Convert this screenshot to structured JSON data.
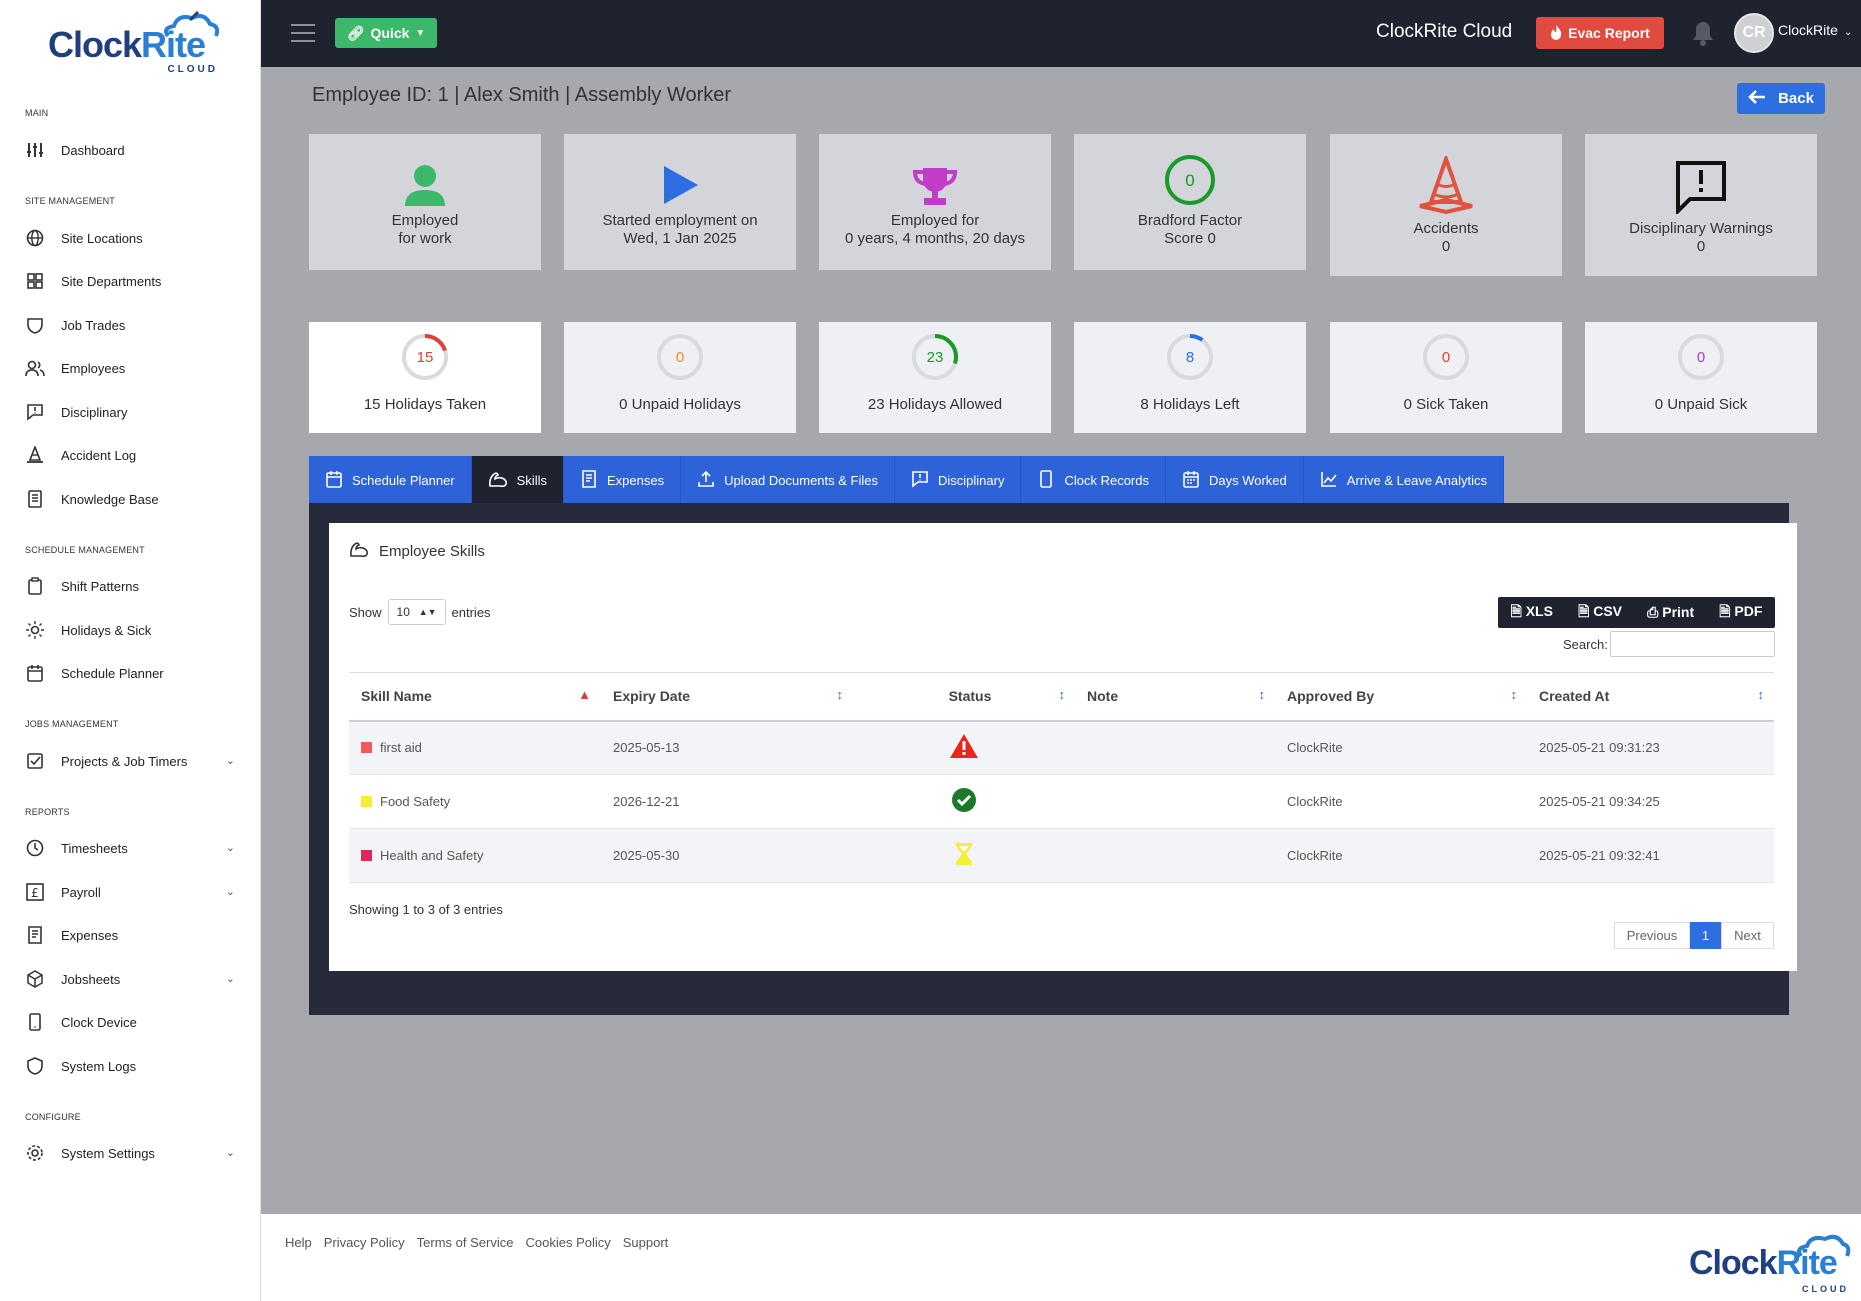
{
  "app": {
    "brand": "ClockRite Cloud",
    "logo_word_1": "Clock",
    "logo_word_2": "Rite",
    "logo_sub": "CLOUD"
  },
  "topbar": {
    "quick_label": "Quick",
    "evac_label": "Evac Report",
    "avatar_initials": "CR",
    "user_name": "ClockRite"
  },
  "sidebar": {
    "sections": [
      "MAIN",
      "SITE MANAGEMENT",
      "SCHEDULE MANAGEMENT",
      "JOBS MANAGEMENT",
      "REPORTS",
      "CONFIGURE"
    ],
    "items": [
      {
        "label": "Dashboard",
        "icon": "sliders-icon"
      },
      {
        "label": "Site Locations",
        "icon": "globe-icon"
      },
      {
        "label": "Site Departments",
        "icon": "grid-icon"
      },
      {
        "label": "Job Trades",
        "icon": "shield-icon"
      },
      {
        "label": "Employees",
        "icon": "users-icon"
      },
      {
        "label": "Disciplinary",
        "icon": "message-alert-icon"
      },
      {
        "label": "Accident Log",
        "icon": "cone-icon"
      },
      {
        "label": "Knowledge Base",
        "icon": "book-icon"
      },
      {
        "label": "Shift Patterns",
        "icon": "clipboard-icon"
      },
      {
        "label": "Holidays & Sick",
        "icon": "sun-icon"
      },
      {
        "label": "Schedule Planner",
        "icon": "calendar-icon"
      },
      {
        "label": "Projects & Job Timers",
        "icon": "checkbox-icon"
      },
      {
        "label": "Timesheets",
        "icon": "clock-icon"
      },
      {
        "label": "Payroll",
        "icon": "pound-icon"
      },
      {
        "label": "Expenses",
        "icon": "receipt-icon"
      },
      {
        "label": "Jobsheets",
        "icon": "box-icon"
      },
      {
        "label": "Clock Device",
        "icon": "tablet-icon"
      },
      {
        "label": "System Logs",
        "icon": "shield-icon"
      },
      {
        "label": "System Settings",
        "icon": "gear-icon"
      }
    ]
  },
  "page": {
    "title": "Employee ID: 1 | Alex Smith | Assembly Worker",
    "back_label": "Back"
  },
  "cards": [
    {
      "line1": "Employed",
      "line2": "for work",
      "icon": "user-icon",
      "color": "#3cb86a"
    },
    {
      "line1": "Started employment on",
      "line2": "Wed, 1 Jan 2025",
      "icon": "play-icon",
      "color": "#2d6fe0"
    },
    {
      "line1": "Employed for",
      "line2": "0 years, 4 months, 20 days",
      "icon": "trophy-icon",
      "color": "#c23dc7"
    },
    {
      "line1": "Bradford Factor",
      "line2": "Score 0",
      "icon": "score-ring",
      "value": "0",
      "color": "#1a9a2a"
    },
    {
      "line1": "Accidents",
      "line2": "0",
      "icon": "cone-icon",
      "color": "#e0533f"
    },
    {
      "line1": "Disciplinary Warnings",
      "line2": "0",
      "icon": "message-alert-icon",
      "color": "#111111"
    }
  ],
  "stats": [
    {
      "value": "15",
      "label": "15 Holidays Taken",
      "fraction": 0.2,
      "color": "#d9433a"
    },
    {
      "value": "0",
      "label": "0 Unpaid Holidays",
      "fraction": 0,
      "color": "#f08c2e"
    },
    {
      "value": "23",
      "label": "23 Holidays Allowed",
      "fraction": 0.3,
      "color": "#1a9a2a"
    },
    {
      "value": "8",
      "label": "8 Holidays Left",
      "fraction": 0.1,
      "color": "#2d6fe0"
    },
    {
      "value": "0",
      "label": "0 Sick Taken",
      "fraction": 0,
      "color": "#d9433a"
    },
    {
      "value": "0",
      "label": "0 Unpaid Sick",
      "fraction": 0,
      "color": "#9b3fd9"
    }
  ],
  "tabs": [
    "Schedule Planner",
    "Skills",
    "Expenses",
    "Upload Documents & Files",
    "Disciplinary",
    "Clock Records",
    "Days Worked",
    "Arrive & Leave Analytics"
  ],
  "skills": {
    "heading": "Employee Skills",
    "show_label": "Show",
    "entries_label": "entries",
    "page_size": "10",
    "exports": [
      "XLS",
      "CSV",
      "Print",
      "PDF"
    ],
    "search_label": "Search:",
    "columns": [
      "Skill Name",
      "Expiry Date",
      "Status",
      "Note",
      "Approved By",
      "Created At"
    ],
    "rows": [
      {
        "name": "first aid",
        "swatch": "#f05a5a",
        "expiry": "2025-05-13",
        "status": "warning",
        "note": "",
        "approved": "ClockRite",
        "created": "2025-05-21 09:31:23"
      },
      {
        "name": "Food Safety",
        "swatch": "#f4ee34",
        "expiry": "2026-12-21",
        "status": "valid",
        "note": "",
        "approved": "ClockRite",
        "created": "2025-05-21 09:34:25"
      },
      {
        "name": "Health and Safety",
        "swatch": "#dc2b5a",
        "expiry": "2025-05-30",
        "status": "pending",
        "note": "",
        "approved": "ClockRite",
        "created": "2025-05-21 09:32:41"
      }
    ],
    "info": "Showing 1 to 3 of 3 entries",
    "pager": {
      "prev": "Previous",
      "page": "1",
      "next": "Next"
    }
  },
  "footer": {
    "links": [
      "Help",
      "Privacy Policy",
      "Terms of Service",
      "Cookies Policy",
      "Support"
    ]
  }
}
